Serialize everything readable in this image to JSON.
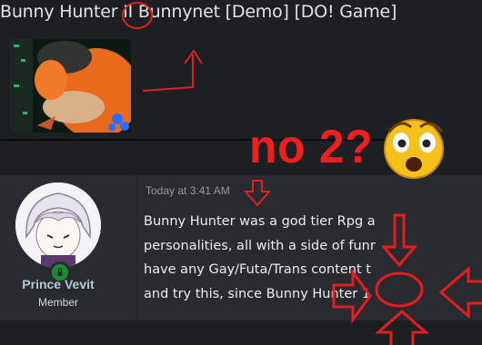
{
  "thread": {
    "title": "Bunny Hunter II Bunnynet [Demo] [DO! Game]"
  },
  "post": {
    "author": {
      "name": "Prince Vevit",
      "role": "Member"
    },
    "timestamp": "Today at 3:41 AM",
    "body_lines": [
      "Bunny Hunter was a god tier Rpg a",
      "personalities, all with a side of funr",
      "have any Gay/Futa/Trans content t",
      "and try this, since Bunny Hunter 1"
    ]
  },
  "annotation": {
    "text": "no 2?",
    "color": "#ef1f1f"
  },
  "icons": {
    "emoji": "astonished-face-icon",
    "status": "online-status-icon"
  }
}
